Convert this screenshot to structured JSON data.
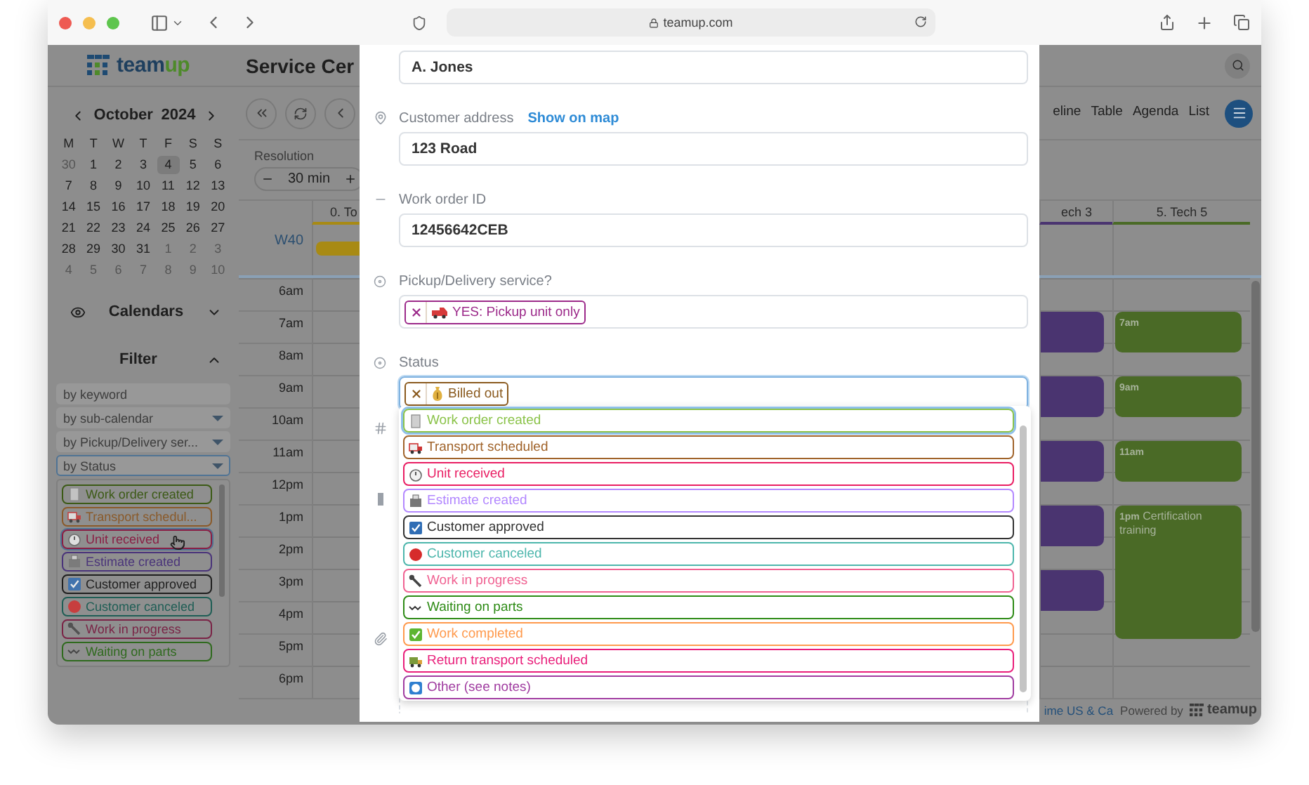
{
  "browser": {
    "url": "teamup.com"
  },
  "header": {
    "brand_parts": [
      "team",
      "up"
    ],
    "title": "Service Cer"
  },
  "mini_calendar": {
    "month": "October",
    "year": "2024",
    "weekdays": [
      "M",
      "T",
      "W",
      "T",
      "F",
      "S",
      "S"
    ],
    "weeks": [
      [
        {
          "d": "30",
          "muted": true,
          "selected": false
        },
        {
          "d": "1",
          "muted": false,
          "selected": false
        },
        {
          "d": "2",
          "muted": false,
          "selected": false
        },
        {
          "d": "3",
          "muted": false,
          "selected": false
        },
        {
          "d": "4",
          "muted": false,
          "selected": true
        },
        {
          "d": "5",
          "muted": false,
          "selected": false
        },
        {
          "d": "6",
          "muted": false,
          "selected": false
        }
      ],
      [
        {
          "d": "7",
          "muted": false,
          "selected": false
        },
        {
          "d": "8",
          "muted": false,
          "selected": false
        },
        {
          "d": "9",
          "muted": false,
          "selected": false
        },
        {
          "d": "10",
          "muted": false,
          "selected": false
        },
        {
          "d": "11",
          "muted": false,
          "selected": false
        },
        {
          "d": "12",
          "muted": false,
          "selected": false
        },
        {
          "d": "13",
          "muted": false,
          "selected": false
        }
      ],
      [
        {
          "d": "14",
          "muted": false,
          "selected": false
        },
        {
          "d": "15",
          "muted": false,
          "selected": false
        },
        {
          "d": "16",
          "muted": false,
          "selected": false
        },
        {
          "d": "17",
          "muted": false,
          "selected": false
        },
        {
          "d": "18",
          "muted": false,
          "selected": false
        },
        {
          "d": "19",
          "muted": false,
          "selected": false
        },
        {
          "d": "20",
          "muted": false,
          "selected": false
        }
      ],
      [
        {
          "d": "21",
          "muted": false,
          "selected": false
        },
        {
          "d": "22",
          "muted": false,
          "selected": false
        },
        {
          "d": "23",
          "muted": false,
          "selected": false
        },
        {
          "d": "24",
          "muted": false,
          "selected": false
        },
        {
          "d": "25",
          "muted": false,
          "selected": false
        },
        {
          "d": "26",
          "muted": false,
          "selected": false
        },
        {
          "d": "27",
          "muted": false,
          "selected": false
        }
      ],
      [
        {
          "d": "28",
          "muted": false,
          "selected": false
        },
        {
          "d": "29",
          "muted": false,
          "selected": false
        },
        {
          "d": "30",
          "muted": false,
          "selected": false
        },
        {
          "d": "31",
          "muted": false,
          "selected": false
        },
        {
          "d": "1",
          "muted": true,
          "selected": false
        },
        {
          "d": "2",
          "muted": true,
          "selected": false
        },
        {
          "d": "3",
          "muted": true,
          "selected": false
        }
      ],
      [
        {
          "d": "4",
          "muted": true,
          "selected": false
        },
        {
          "d": "5",
          "muted": true,
          "selected": false
        },
        {
          "d": "6",
          "muted": true,
          "selected": false
        },
        {
          "d": "7",
          "muted": true,
          "selected": false
        },
        {
          "d": "8",
          "muted": true,
          "selected": false
        },
        {
          "d": "9",
          "muted": true,
          "selected": false
        },
        {
          "d": "10",
          "muted": true,
          "selected": false
        }
      ]
    ]
  },
  "calendars": {
    "label": "Calendars",
    "expanded": false
  },
  "filter": {
    "label": "Filter",
    "expanded": true,
    "fields": [
      {
        "label": "by keyword",
        "kind": "text",
        "focused": false
      },
      {
        "label": "by sub-calendar",
        "kind": "select",
        "focused": false
      },
      {
        "label": "by Pickup/Delivery ser...",
        "kind": "select",
        "focused": false
      },
      {
        "label": "by Status",
        "kind": "select",
        "focused": true
      }
    ],
    "status_options": [
      {
        "label": "Work order created",
        "color": "#3c5a16",
        "hovered": false
      },
      {
        "label": "Transport schedul...",
        "color": "#8a5a2a",
        "hovered": false
      },
      {
        "label": "Unit received",
        "color": "#8a1e44",
        "hovered": true
      },
      {
        "label": "Estimate created",
        "color": "#4a347a",
        "hovered": false
      },
      {
        "label": "Customer approved",
        "color": "#1e1e1e",
        "hovered": false
      },
      {
        "label": "Customer canceled",
        "color": "#1f5e55",
        "hovered": false
      },
      {
        "label": "Work in progress",
        "color": "#7a2446",
        "hovered": false
      },
      {
        "label": "Waiting on parts",
        "color": "#2f6a1e",
        "hovered": false
      }
    ]
  },
  "resolution": {
    "label": "Resolution",
    "value": "30 min"
  },
  "view_tabs": [
    {
      "label": "eline",
      "selected": false
    },
    {
      "label": "Table",
      "selected": false
    },
    {
      "label": "Agenda",
      "selected": false
    },
    {
      "label": "List",
      "selected": false
    }
  ],
  "columns": [
    {
      "label": "0. To",
      "color": "#a88a14"
    },
    {
      "label": "ech 3",
      "color": "#4a3470"
    },
    {
      "label": "5. Tech 5",
      "color": "#4a6a26"
    }
  ],
  "week_label": "W40",
  "hours": [
    "6am",
    "7am",
    "8am",
    "9am",
    "10am",
    "11am",
    "12pm",
    "1pm",
    "2pm",
    "3pm",
    "4pm",
    "5pm",
    "6pm"
  ],
  "tech5_events": [
    {
      "time": "7am"
    },
    {
      "time": "9am"
    },
    {
      "time": "11am"
    },
    {
      "time": "1pm",
      "title": "Certification training"
    }
  ],
  "footer": {
    "timezone": "ime US & Ca",
    "powered_by": "Powered by",
    "brand": "teamup"
  },
  "event_form": {
    "fields": [
      {
        "kind": "text",
        "value": "A. Jones"
      },
      {
        "kind": "text",
        "label": "Customer address",
        "link": "Show on map",
        "value": "123 Road"
      },
      {
        "kind": "text",
        "label": "Work order ID",
        "value": "12456642CEB"
      },
      {
        "kind": "choice",
        "label": "Pickup/Delivery service?",
        "focused": false,
        "chips": [
          {
            "label": "YES: Pickup unit only",
            "color": "#9c2a8a"
          }
        ]
      },
      {
        "kind": "choice",
        "label": "Status",
        "focused": true,
        "chips": [
          {
            "label": "Billed out",
            "color": "#8a5a1e"
          }
        ]
      }
    ],
    "status_dropdown": [
      {
        "label": "Work order created",
        "color": "#8bc34a",
        "highlighted": true
      },
      {
        "label": "Transport scheduled",
        "color": "#a0632a",
        "highlighted": false
      },
      {
        "label": "Unit received",
        "color": "#e91e63",
        "highlighted": false
      },
      {
        "label": "Estimate created",
        "color": "#b388ff",
        "highlighted": false
      },
      {
        "label": "Customer approved",
        "color": "#333333",
        "highlighted": false
      },
      {
        "label": "Customer canceled",
        "color": "#4db6ac",
        "highlighted": false
      },
      {
        "label": "Work in progress",
        "color": "#f06292",
        "highlighted": false
      },
      {
        "label": "Waiting on parts",
        "color": "#2e8b16",
        "highlighted": false
      },
      {
        "label": "Work completed",
        "color": "#ff9a4d",
        "highlighted": false
      },
      {
        "label": "Return transport scheduled",
        "color": "#e91e7a",
        "highlighted": false
      },
      {
        "label": "Other (see notes)",
        "color": "#a03ca0",
        "highlighted": false
      }
    ]
  }
}
